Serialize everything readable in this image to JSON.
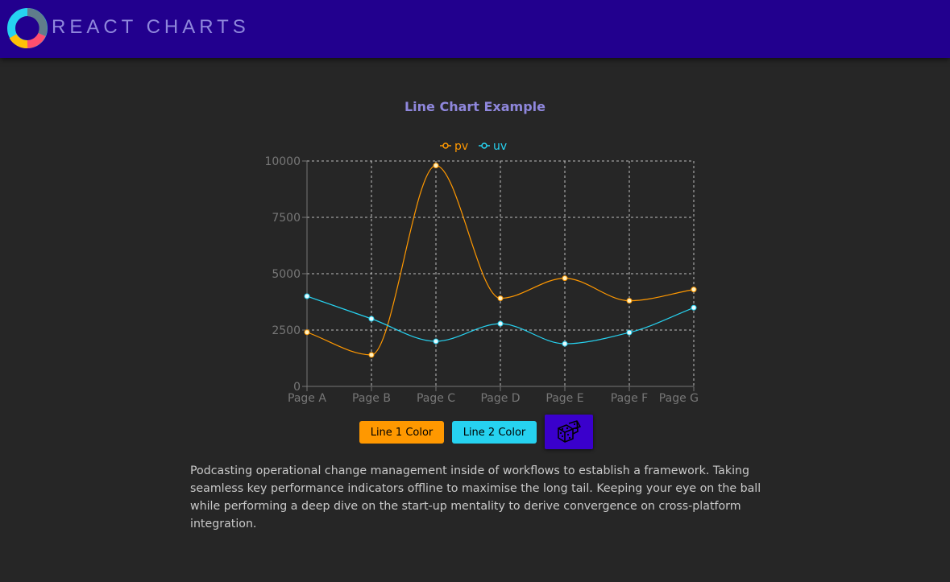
{
  "app": {
    "title": "REACT CHARTS"
  },
  "colors": {
    "header": "#22008e",
    "pv": "#ff9800",
    "uv": "#26d2f0",
    "grid": "#bdbdbd",
    "axis": "#777777"
  },
  "chart_data": {
    "type": "line",
    "title": "Line Chart Example",
    "categories": [
      "Page A",
      "Page B",
      "Page C",
      "Page D",
      "Page E",
      "Page F",
      "Page G"
    ],
    "series": [
      {
        "name": "pv",
        "values": [
          2400,
          1398,
          9800,
          3908,
          4800,
          3800,
          4300
        ]
      },
      {
        "name": "uv",
        "values": [
          4000,
          3000,
          2000,
          2780,
          1890,
          2390,
          3490
        ]
      }
    ],
    "ylim": [
      0,
      10000
    ],
    "yticks": [
      0,
      2500,
      5000,
      7500,
      10000
    ],
    "grid": true,
    "legend": "top-center",
    "xlabel": "",
    "ylabel": ""
  },
  "controls": {
    "line1_label": "Line 1 Color",
    "line2_label": "Line 2 Color",
    "random_icon": "dice-icon"
  },
  "description": "Podcasting operational change management inside of workflows to establish a framework. Taking seamless key performance indicators offline to maximise the long tail. Keeping your eye on the ball while performing a deep dive on the start-up mentality to derive convergence on cross-platform integration."
}
